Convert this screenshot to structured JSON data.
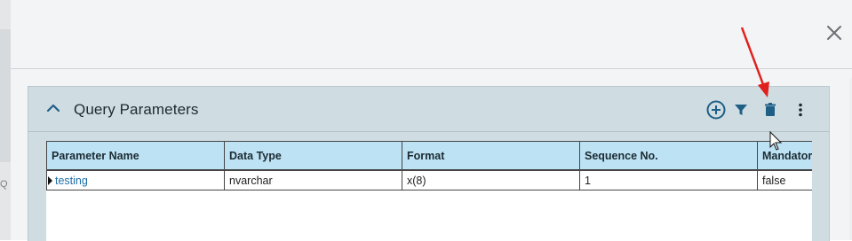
{
  "background": {
    "left_letter": "Q"
  },
  "modal": {
    "close_icon": "close-icon"
  },
  "panel": {
    "title": "Query Parameters",
    "toolbar": {
      "add_icon": "plus-circle-icon",
      "filter_icon": "filter-icon",
      "delete_icon": "trash-icon",
      "more_icon": "vertical-ellipsis-icon"
    }
  },
  "grid": {
    "columns": [
      "Parameter Name",
      "Data Type",
      "Format",
      "Sequence No.",
      "Mandatory"
    ],
    "rows": [
      {
        "name": "testing",
        "data_type": "nvarchar",
        "format": "x(8)",
        "sequence": "1",
        "mandatory": "false"
      }
    ]
  },
  "colors": {
    "panel_bg": "#cfdde2",
    "header_bg": "#bde2f3",
    "link": "#1d6fa7",
    "icon": "#1f5f86",
    "annotation_arrow": "#e0201c"
  }
}
